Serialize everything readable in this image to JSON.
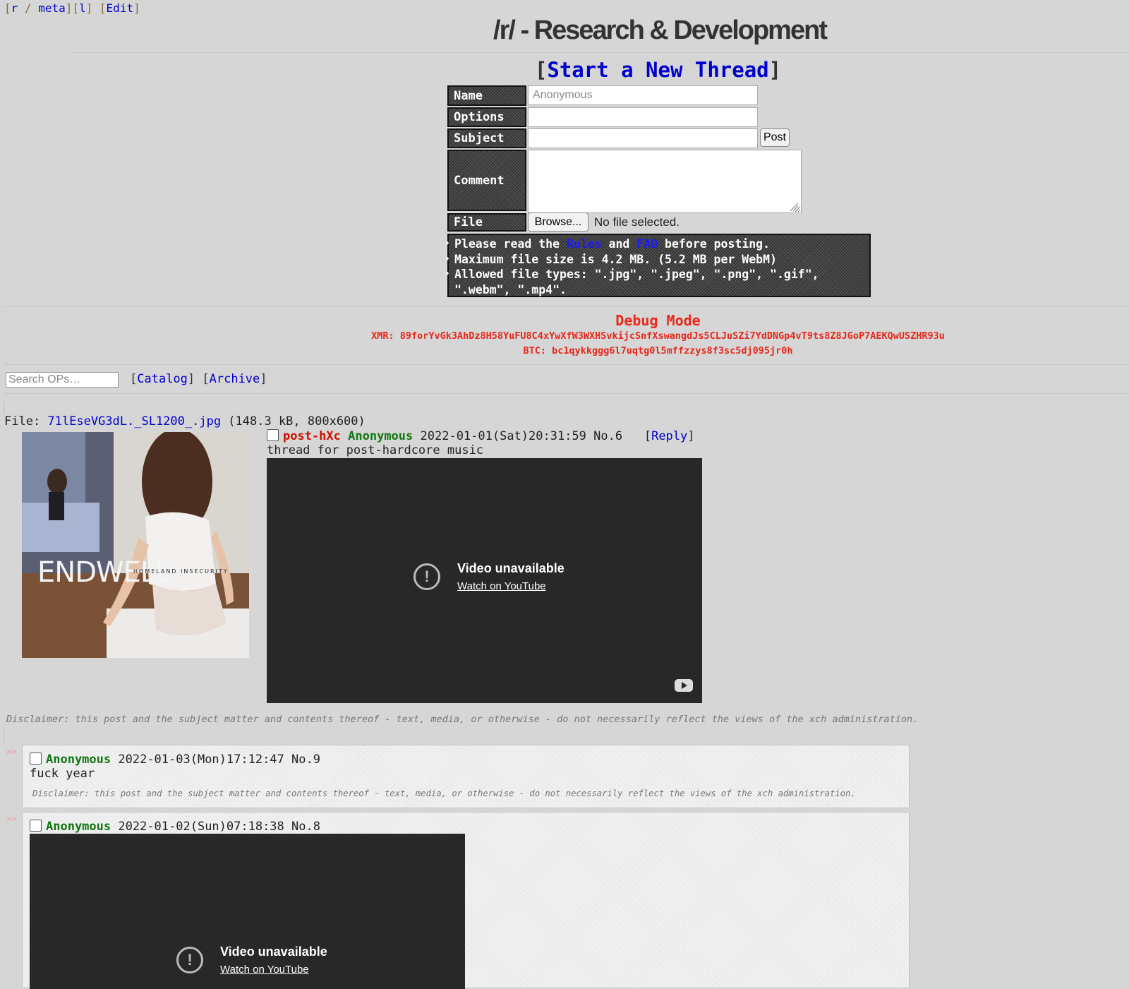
{
  "topnav": {
    "board": "r",
    "sep": "/",
    "meta": "meta",
    "l": "l",
    "edit": "Edit"
  },
  "title": "/r/ - Research & Development",
  "new_thread": "Start a New Thread",
  "form": {
    "name_label": "Name",
    "name_placeholder": "Anonymous",
    "options_label": "Options",
    "subject_label": "Subject",
    "comment_label": "Comment",
    "file_label": "File",
    "post_button": "Post",
    "browse_button": "Browse...",
    "no_file": "No file selected."
  },
  "rules": {
    "line1_pre": "Please read the ",
    "rules_link": "Rules",
    "and": " and ",
    "faq_link": "FAQ",
    "line1_post": " before posting.",
    "line2": "Maximum file size is 4.2 MB. (5.2 MB per WebM)",
    "line3": "Allowed file types: \".jpg\", \".jpeg\", \".png\", \".gif\", \".webm\", \".mp4\"."
  },
  "debug": {
    "title": "Debug Mode",
    "xmr": "XMR: 89forYvGk3AhDz8H58YuFU8C4xYwXfW3WXHSvkijcSnfXswangdJs5CLJuSZi7YdDNGp4vT9ts8Z8JGoP7AEKQwUSZHR93u",
    "btc": "BTC: bc1qykkggg6l7uqtg0l5mffzzys8f3sc5dj095jr0h"
  },
  "search_placeholder": "Search OPs…",
  "nav": {
    "catalog": "Catalog",
    "archive": "Archive"
  },
  "op": {
    "file_prefix": "File: ",
    "file_name": "71lEseVG3dL._SL1200_.jpg",
    "file_meta": " (148.3 kB, 800x600)",
    "thumb_band": "ENDWELL",
    "thumb_album": "HOMELAND INSECURITY",
    "subject": "post-hXc",
    "name": "Anonymous",
    "date": "2022-01-01(Sat)20:31:59",
    "no": "No.6",
    "reply_link": "Reply",
    "message": "thread for post-hardcore music",
    "video_title": "Video unavailable",
    "video_link": "Watch on YouTube"
  },
  "disclaimer": "Disclaimer: this post and the subject matter and contents thereof - text, media, or otherwise - do not necessarily reflect the views of the xch administration.",
  "replies": [
    {
      "arrows": ">>",
      "name": "Anonymous",
      "date": "2022-01-03(Mon)17:12:47",
      "no": "No.9",
      "message": "fuck year"
    },
    {
      "arrows": ">>",
      "name": "Anonymous",
      "date": "2022-01-02(Sun)07:18:38",
      "no": "No.8",
      "video_title": "Video unavailable",
      "video_link": "Watch on YouTube"
    }
  ],
  "colors": {
    "link": "#0000cc",
    "subject": "#cc1100",
    "poster": "#117711",
    "debug": "#e8281a",
    "background": "#d6d6d6"
  }
}
